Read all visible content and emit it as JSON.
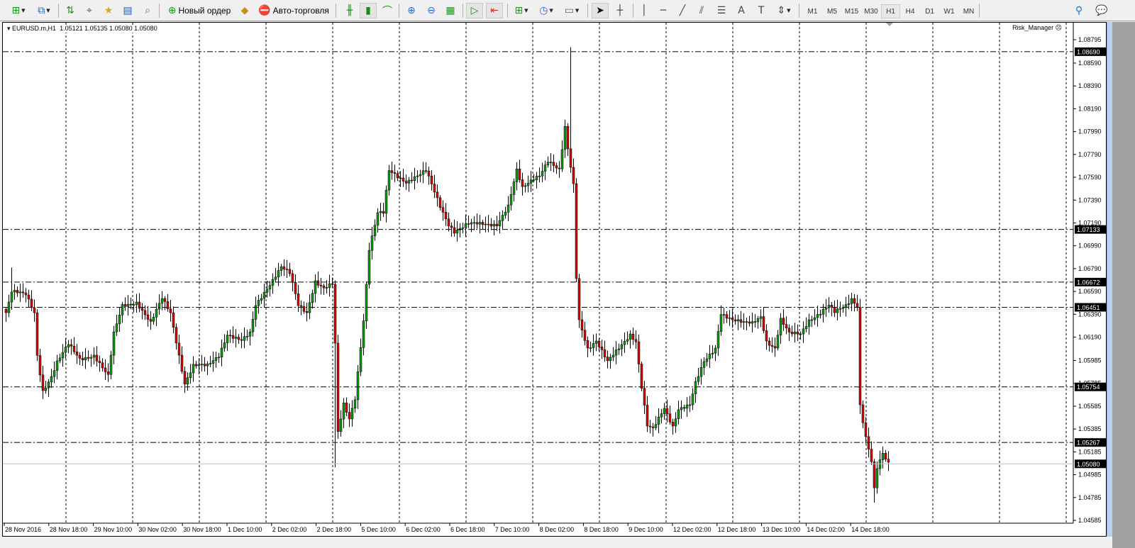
{
  "toolbar": {
    "new_order_label": "Новый ордер",
    "auto_trading_label": "Авто-торговля",
    "timeframes": [
      "M1",
      "M5",
      "M15",
      "M30",
      "H1",
      "H4",
      "D1",
      "W1",
      "MN"
    ],
    "active_timeframe": "H1"
  },
  "chart": {
    "symbol_label": "EURUSD.m,H1",
    "ohlc": "1.05121 1.05135 1.05080 1.05080",
    "indicator_label": "Risk_Manager",
    "colors": {
      "bull": "#00a000",
      "bear": "#e00000",
      "grid": "#000000",
      "bid_line": "#c0c0c0"
    },
    "price_ticks": [
      "1.08795",
      "1.08590",
      "1.08390",
      "1.08190",
      "1.07990",
      "1.07790",
      "1.07590",
      "1.07390",
      "1.07190",
      "1.06990",
      "1.06790",
      "1.06590",
      "1.06390",
      "1.06190",
      "1.05985",
      "1.05785",
      "1.05585",
      "1.05385",
      "1.05185",
      "1.04985",
      "1.04785",
      "1.04585"
    ],
    "level_lines": [
      "1.08690",
      "1.07133",
      "1.06672",
      "1.06451",
      "1.05754",
      "1.05267"
    ],
    "bid": "1.05080",
    "time_ticks": [
      "28 Nov 2016",
      "28 Nov 18:00",
      "29 Nov 10:00",
      "30 Nov 02:00",
      "30 Nov 18:00",
      "1 Dec 10:00",
      "2 Dec 02:00",
      "2 Dec 18:00",
      "5 Dec 10:00",
      "6 Dec 02:00",
      "6 Dec 18:00",
      "7 Dec 10:00",
      "8 Dec 02:00",
      "8 Dec 18:00",
      "9 Dec 10:00",
      "12 Dec 02:00",
      "12 Dec 18:00",
      "13 Dec 10:00",
      "14 Dec 02:00",
      "14 Dec 18:00"
    ],
    "close_path": [
      [
        0,
        1.06404
      ],
      [
        2,
        1.0659
      ],
      [
        7,
        1.06559
      ],
      [
        10,
        1.06404
      ],
      [
        11,
        1.06032
      ],
      [
        13,
        1.05721
      ],
      [
        16,
        1.05845
      ],
      [
        18,
        1.05969
      ],
      [
        22,
        1.06125
      ],
      [
        26,
        1.06
      ],
      [
        31,
        1.06032
      ],
      [
        36,
        1.05845
      ],
      [
        38,
        1.06218
      ],
      [
        41,
        1.06466
      ],
      [
        46,
        1.06497
      ],
      [
        51,
        1.06311
      ],
      [
        55,
        1.06528
      ],
      [
        58,
        1.06404
      ],
      [
        61,
        1.06032
      ],
      [
        63,
        1.05783
      ],
      [
        66,
        1.05938
      ],
      [
        71,
        1.05938
      ],
      [
        75,
        1.06032
      ],
      [
        78,
        1.06218
      ],
      [
        83,
        1.06156
      ],
      [
        86,
        1.06218
      ],
      [
        88,
        1.06466
      ],
      [
        92,
        1.06621
      ],
      [
        97,
        1.06808
      ],
      [
        100,
        1.06746
      ],
      [
        103,
        1.06466
      ],
      [
        106,
        1.06404
      ],
      [
        109,
        1.06684
      ],
      [
        112,
        1.06621
      ],
      [
        115,
        1.06653
      ],
      [
        116,
        1.06125
      ],
      [
        117,
        1.05348
      ],
      [
        119,
        1.05597
      ],
      [
        121,
        1.05473
      ],
      [
        123,
        1.05659
      ],
      [
        126,
        1.06342
      ],
      [
        128,
        1.06963
      ],
      [
        131,
        1.07274
      ],
      [
        133,
        1.07274
      ],
      [
        135,
        1.07646
      ],
      [
        137,
        1.07615
      ],
      [
        141,
        1.07553
      ],
      [
        146,
        1.07615
      ],
      [
        148,
        1.07646
      ],
      [
        151,
        1.0746
      ],
      [
        153,
        1.07336
      ],
      [
        156,
        1.0718
      ],
      [
        158,
        1.07118
      ],
      [
        163,
        1.0718
      ],
      [
        168,
        1.0718
      ],
      [
        173,
        1.0718
      ],
      [
        177,
        1.07336
      ],
      [
        180,
        1.07646
      ],
      [
        182,
        1.07491
      ],
      [
        186,
        1.07584
      ],
      [
        188,
        1.07615
      ],
      [
        191,
        1.07739
      ],
      [
        195,
        1.07646
      ],
      [
        197,
        1.08019
      ],
      [
        198,
        1.07832
      ],
      [
        200,
        1.07522
      ],
      [
        201,
        1.06715
      ],
      [
        202,
        1.06342
      ],
      [
        205,
        1.06094
      ],
      [
        208,
        1.06156
      ],
      [
        212,
        1.05969
      ],
      [
        216,
        1.06094
      ],
      [
        220,
        1.06218
      ],
      [
        222,
        1.06156
      ],
      [
        224,
        1.05752
      ],
      [
        226,
        1.05411
      ],
      [
        228,
        1.05379
      ],
      [
        232,
        1.05566
      ],
      [
        235,
        1.05411
      ],
      [
        237,
        1.05566
      ],
      [
        241,
        1.05597
      ],
      [
        243,
        1.05783
      ],
      [
        246,
        1.05969
      ],
      [
        250,
        1.06094
      ],
      [
        252,
        1.06404
      ],
      [
        256,
        1.06342
      ],
      [
        260,
        1.06311
      ],
      [
        263,
        1.06311
      ],
      [
        266,
        1.06373
      ],
      [
        268,
        1.06156
      ],
      [
        271,
        1.06094
      ],
      [
        273,
        1.06342
      ],
      [
        276,
        1.06218
      ],
      [
        280,
        1.06218
      ],
      [
        283,
        1.06342
      ],
      [
        287,
        1.06404
      ],
      [
        290,
        1.06466
      ],
      [
        292,
        1.06404
      ],
      [
        296,
        1.06466
      ],
      [
        298,
        1.06528
      ],
      [
        300,
        1.06466
      ],
      [
        301,
        1.05597
      ],
      [
        303,
        1.05317
      ],
      [
        305,
        1.051
      ],
      [
        306,
        1.04852
      ],
      [
        307,
        1.05038
      ],
      [
        309,
        1.05162
      ],
      [
        311,
        1.0508
      ]
    ],
    "extremes": [
      {
        "bar": 2,
        "high": 1.068
      },
      {
        "bar": 116,
        "low": 1.0505
      },
      {
        "bar": 199,
        "high": 1.0873
      },
      {
        "bar": 306,
        "low": 1.0474
      }
    ]
  }
}
